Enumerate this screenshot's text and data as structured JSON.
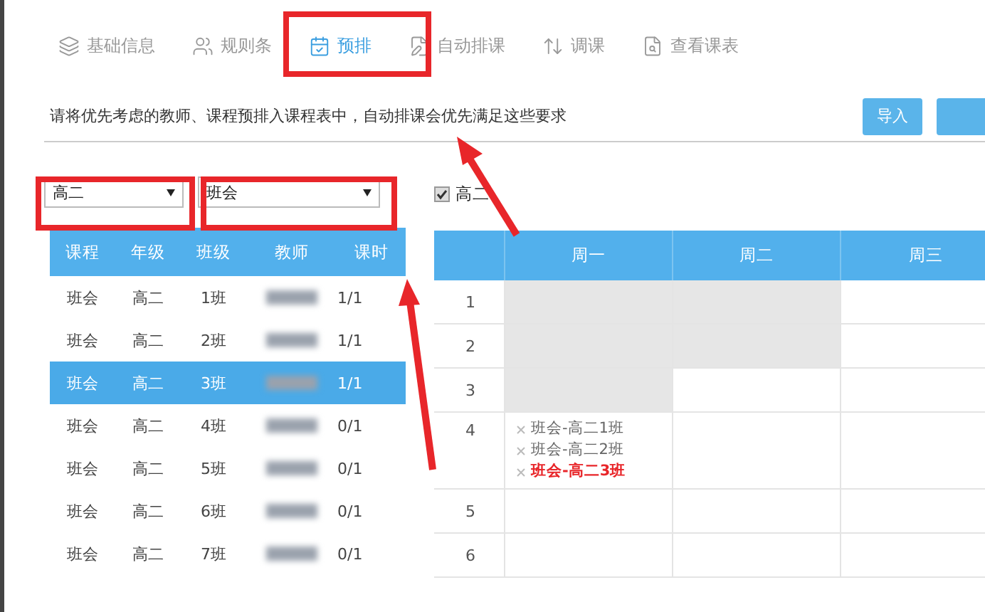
{
  "tabs": [
    {
      "label": "基础信息",
      "selected": false
    },
    {
      "label": "规则条",
      "selected": false
    },
    {
      "label": "预排",
      "selected": true
    },
    {
      "label": "自动排课",
      "selected": false
    },
    {
      "label": "调课",
      "selected": false
    },
    {
      "label": "查看课表",
      "selected": false
    }
  ],
  "instruction": "请将优先考虑的教师、课程预排入课程表中，自动排课会优先满足这些要求",
  "buttons": [
    "导入"
  ],
  "filters": [
    {
      "value": "高二"
    },
    {
      "value": "班会"
    }
  ],
  "course_table": {
    "columns": [
      "课程",
      "年级",
      "班级",
      "教师",
      "课时"
    ],
    "rows": [
      {
        "cells": [
          "班会",
          "高二",
          "1班",
          null,
          "1/1"
        ],
        "selected": false
      },
      {
        "cells": [
          "班会",
          "高二",
          "2班",
          null,
          "1/1"
        ],
        "selected": false
      },
      {
        "cells": [
          "班会",
          "高二",
          "3班",
          null,
          "1/1"
        ],
        "selected": true
      },
      {
        "cells": [
          "班会",
          "高二",
          "4班",
          null,
          "0/1"
        ],
        "selected": false
      },
      {
        "cells": [
          "班会",
          "高二",
          "5班",
          null,
          "0/1"
        ],
        "selected": false
      },
      {
        "cells": [
          "班会",
          "高二",
          "6班",
          null,
          "0/1"
        ],
        "selected": false
      },
      {
        "cells": [
          "班会",
          "高二",
          "7班",
          null,
          "0/1"
        ],
        "selected": false
      }
    ]
  },
  "grade_check": {
    "label": "高二",
    "checked": true
  },
  "timetable": {
    "columns": [
      "周一",
      "周二",
      "周三"
    ],
    "rows": [
      {
        "period": "1",
        "cells": [
          {
            "blocked": true
          },
          {
            "blocked": true
          },
          {
            "blocked": false
          }
        ]
      },
      {
        "period": "2",
        "cells": [
          {
            "blocked": true
          },
          {
            "blocked": true
          },
          {
            "blocked": false
          }
        ]
      },
      {
        "period": "3",
        "cells": [
          {
            "blocked": true
          },
          {
            "blocked": false
          },
          {
            "blocked": false
          }
        ]
      },
      {
        "period": "4",
        "cells": [
          {
            "blocked": false,
            "entries": [
              {
                "label": "班会-高二1班",
                "selected": false
              },
              {
                "label": "班会-高二2班",
                "selected": false
              },
              {
                "label": "班会-高二3班",
                "selected": true
              }
            ]
          },
          {
            "blocked": false
          },
          {
            "blocked": false
          }
        ]
      },
      {
        "period": "5",
        "cells": [
          {
            "blocked": false
          },
          {
            "blocked": false
          },
          {
            "blocked": false
          }
        ]
      },
      {
        "period": "6",
        "cells": [
          {
            "blocked": false
          },
          {
            "blocked": false
          },
          {
            "blocked": false
          }
        ]
      }
    ]
  }
}
